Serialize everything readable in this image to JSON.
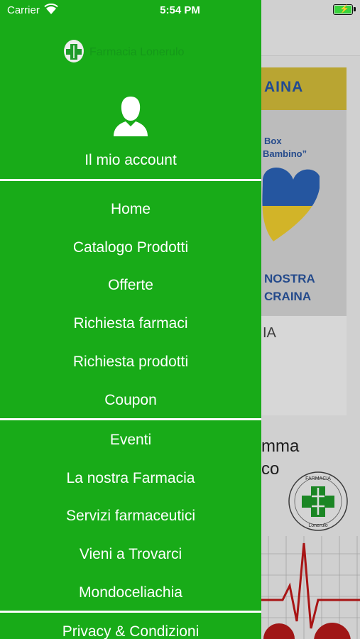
{
  "status_bar": {
    "carrier": "Carrier",
    "time": "5:54 PM"
  },
  "side_menu": {
    "brand_name": "Farmacia Lonerulo",
    "account_label": "Il mio account",
    "items": [
      "Home",
      "Catalogo Prodotti",
      "Offerte",
      "Richiesta farmaci",
      "Richiesta prodotti",
      "Coupon",
      "Eventi",
      "La nostra Farmacia",
      "Servizi farmaceutici",
      "Vieni a Trovarci",
      "Mondoceliachia",
      "Privacy & Condizioni"
    ]
  },
  "background": {
    "banner_text": "AINA",
    "box_title_1": "Box",
    "box_title_2": "Bambino”",
    "box_line_1": "NOSTRA",
    "box_line_2": "CRAINA",
    "card_caption": "IA",
    "prog_line_1": "mma",
    "prog_line_2": "co",
    "logo_top": "FARMACIA",
    "logo_bottom": "Lonerulo"
  },
  "colors": {
    "menu_green": "#18ab18",
    "divider": "#ffffff",
    "text": "#ffffff"
  },
  "icons": [
    "wifi-icon",
    "battery-icon",
    "user-icon",
    "pharmacy-logo"
  ]
}
